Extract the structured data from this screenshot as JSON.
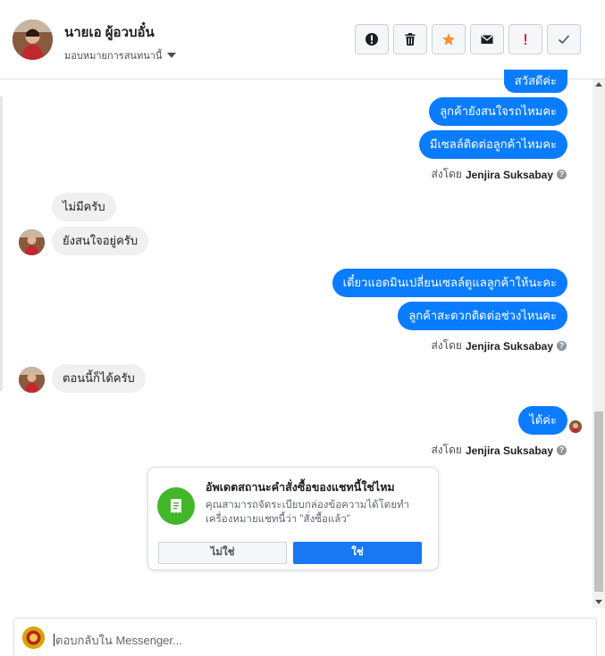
{
  "header": {
    "name": "นายเอ ผู้อวบอั๋น",
    "assign_label": "มอบหมายการสนทนานี้",
    "tools": [
      {
        "icon": "alert-circle-icon",
        "label": "spam"
      },
      {
        "icon": "trash-icon",
        "label": "delete"
      },
      {
        "icon": "star-icon",
        "label": "star"
      },
      {
        "icon": "envelope-icon",
        "label": "mark unread"
      },
      {
        "icon": "exclamation-icon",
        "label": "follow up"
      },
      {
        "icon": "check-icon",
        "label": "done"
      }
    ]
  },
  "messages": {
    "top_partial": "สวัสดีค่ะ",
    "m1": "ลูกค้ายังสนใจรถไหมคะ",
    "m2": "มีเซลล์ติดต่อลูกค้าไหมคะ",
    "sent_prefix": "ส่งโดย",
    "sent_by": "Jenjira Suksabay",
    "r1": "ไม่มีครับ",
    "r2": "ยังสนใจอยู่ครับ",
    "m3": "เดี๋ยวแอดมินเปลี่ยนเซลล์ดูแลลูกค้าให้นะคะ",
    "m4": "ลูกค้าสะดวกติดต่อช่วงไหนคะ",
    "r3": "ตอนนี้ก็ได้ครับ",
    "m5": "ได้ค่ะ"
  },
  "prompt": {
    "title": "อัพเดตสถานะคำสั่งซื้อของแชทนี้ใช่ไหม",
    "desc": "คุณสามารถจัดระเบียบกล่องข้อความได้โดยทำเครื่องหมายแชทนี้ว่า \"สั่งซื้อแล้ว\"",
    "no_label": "ไม่ใช่",
    "yes_label": "ใช่"
  },
  "composer": {
    "placeholder": "ตอบกลับใน Messenger..."
  },
  "colors": {
    "outgoing_bubble": "#0a7cff",
    "incoming_bubble": "#f1f0f0",
    "primary_button": "#1877f2",
    "prompt_icon": "#42b72a",
    "star": "#f7923b",
    "alert_red": "#e41e3f"
  }
}
